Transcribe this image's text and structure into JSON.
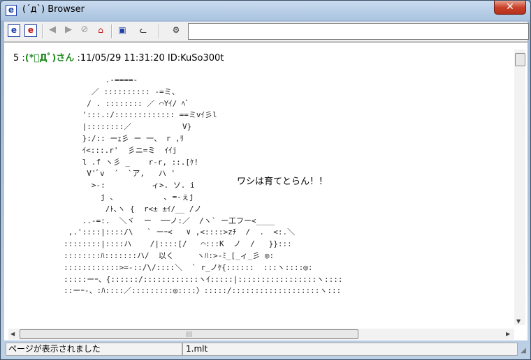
{
  "window": {
    "title": "(´д`) Browser",
    "close_glyph": "✕"
  },
  "toolbar": {
    "btn_ie": "e",
    "btn_ie2": "e",
    "btn_back": "◀",
    "btn_forward": "▶",
    "btn_stop": "⊘",
    "btn_home": "⌂",
    "btn_favorites": "▣",
    "btn_cat": "ᓚ",
    "btn_config": "⚙",
    "address_value": ""
  },
  "post": {
    "number": "5 :",
    "name": "(*ﾟДﾟ)さん",
    "meta": " :11/05/29 11:31:20 ID:KuSo300t",
    "ascii_art": "              .-====-\n           ／ :::::::::: -=ミ、\n          / . :::::::: ／ ⌒Yｲ/ ﾍﾞ\n         ':::.:/::::::::::::: ==ミvｲ彡l\n         |::::::::／           V}\n         }:/:: ーｪ彡 ー 一、 r ,ﾘ\n         ｲ<:::.r'  彡ニ=ミ  ｲｲj\n         l .f ヽ彡 _    r-r, ::.[ｹ!\n          V'ﾞv  ´  `ア,   ハ '\n           >-:          ィ>. ソ. i\n             j 、          ､ =-ぇj\n              /ﾄ､ヽ {  r<± ±ｲ/__ /ノ\n         ..-=:.  ＼ヾ  ー  ──ノ:／  /ヽ` ー工フー<____\n      ,.'::::|::::/\\   ` ーｰ<   ∨ ,<::::>zﾁ  /  .  <:.＼\n     ::::::::|::::ハ    /|::::[/   ⌒:::K  ノ  /   }}:::\n     ::::::::ﾊ:::::::ハ/  以く     ヽﾊ:>-ﾐ_[_ィ_彡 ◎:\n     ::::::::::::>=-::/\\/::::＼  ` r_ノｹ{::::::  :::ヽ::::◎:\n     :::::ーｰ、{::::::/::::::::::::ヽｲ:::::|:::::::::::::::::ヽ::::\n     ::ーｰ-、:ﾊ::::／:::::::::◎::::〉:::::/:::::::::::::::::::ヽ:::",
    "speech": "ワシは育てとらん！！"
  },
  "scrollbar": {
    "h_thumb_glyph": "|||",
    "up_arrow": "▲",
    "down_arrow": "▼",
    "left_arrow": "◀",
    "right_arrow": "▶"
  },
  "status": {
    "message": "ページが表示されました",
    "file": "1.mlt"
  }
}
